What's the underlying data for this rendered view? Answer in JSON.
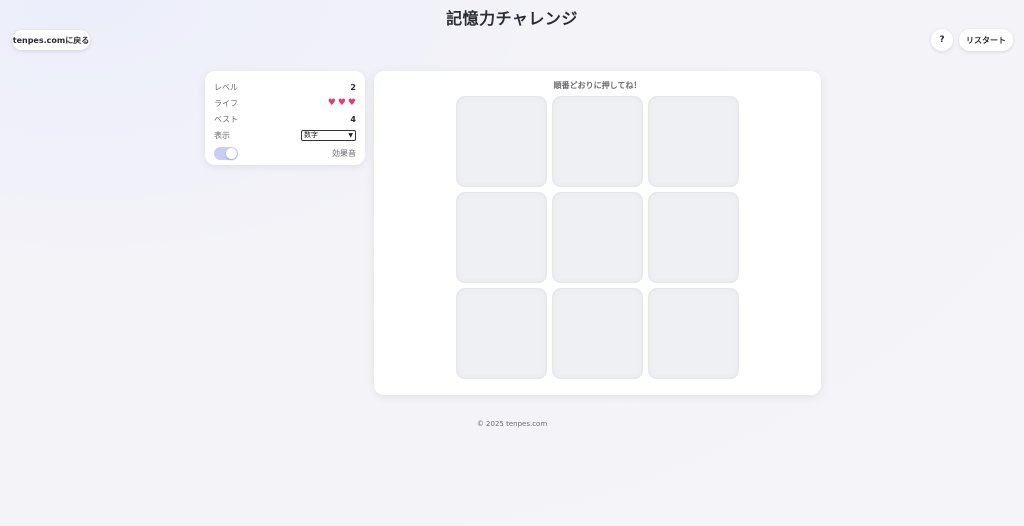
{
  "header": {
    "title": "記憶力チャレンジ",
    "back_label": "tenpes.comに戻る",
    "help_label": "?",
    "restart_label": "リスタート"
  },
  "stats": {
    "level_label": "レベル",
    "level_value": "2",
    "life_label": "ライフ",
    "lives": 3,
    "heart_glyph": "♥",
    "best_label": "ベスト",
    "best_value": "4",
    "display_label": "表示",
    "display_selected": "数字",
    "sound_label": "効果音",
    "sound_enabled": true
  },
  "board": {
    "instruction": "順番どおりに押してね！",
    "tile_count": 9
  },
  "footer": {
    "copyright": "© 2025 tenpes.com"
  },
  "colors": {
    "heart": "#e83a6c",
    "toggle_on": "#c8cdf3",
    "tile": "#eef0f4"
  }
}
